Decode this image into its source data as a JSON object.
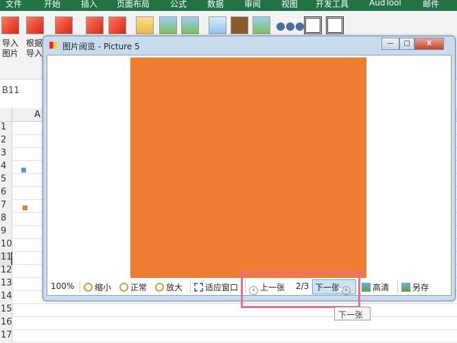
{
  "menu": [
    "文件",
    "开始",
    "插入",
    "页面布局",
    "公式",
    "数据",
    "审阅",
    "视图",
    "开发工具",
    "AudTool",
    "邮件"
  ],
  "ribbon": {
    "labels": [
      [
        "导入",
        "图片"
      ],
      [
        "根据",
        "导入"
      ]
    ]
  },
  "namebox": "B11",
  "column_header": "A",
  "rows": [
    "1",
    "2",
    "3",
    "4",
    "5",
    "6",
    "7",
    "8",
    "9",
    "10",
    "11",
    "12",
    "13",
    "14",
    "15",
    "16",
    "17"
  ],
  "dialog": {
    "title": "图片阅览 - Picture 5",
    "minimize": "—",
    "maximize": "□",
    "close": "X",
    "image_color": "#ed7d31",
    "zoom": "100%",
    "zoom_out": "缩小",
    "normal": "正常",
    "zoom_in": "放大",
    "fit": "适应窗口",
    "prev": "上一张",
    "page": "2/3",
    "next": "下一张",
    "hd": "高清",
    "save_as": "另存"
  },
  "tooltip": "下一张",
  "colors": {
    "accent": "#217346",
    "highlight": "#f06a96",
    "selected": "#cde4f7"
  }
}
